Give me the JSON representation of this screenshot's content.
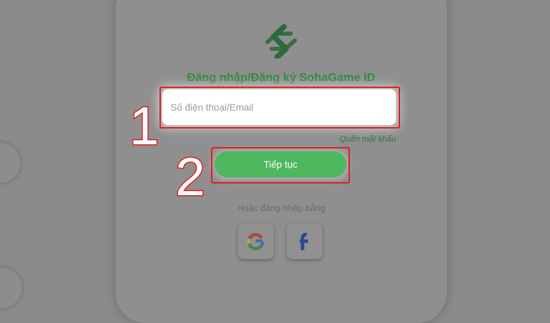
{
  "form": {
    "title": "Đăng nhập/Đăng ký SohaGame ID",
    "input_placeholder": "Số điện thoại/Email",
    "forgot_label": "Quên mật khẩu",
    "continue_label": "Tiếp tục",
    "alt_login_label": "Hoặc đăng nhập bằng"
  },
  "annotations": {
    "step1": "1",
    "step2": "2"
  },
  "social": {
    "google_icon": "google-icon",
    "facebook_icon": "facebook-icon"
  },
  "colors": {
    "brand_green": "#2c8c42",
    "button_green": "#4fb75e",
    "annotation_red": "#e21b1b"
  }
}
